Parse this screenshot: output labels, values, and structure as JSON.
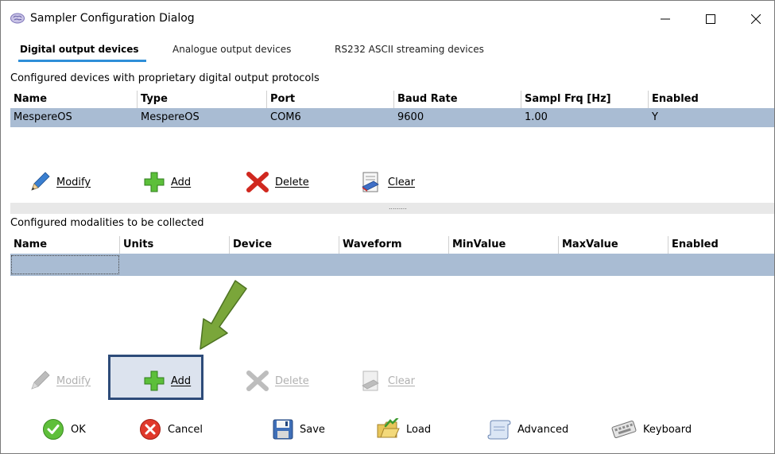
{
  "window": {
    "title": "Sampler Configuration Dialog"
  },
  "tabs": [
    {
      "label": "Digital output devices",
      "active": true
    },
    {
      "label": "Analogue output devices",
      "active": false
    },
    {
      "label": "RS232 ASCII streaming devices",
      "active": false
    }
  ],
  "devices": {
    "section_label": "Configured devices with proprietary digital output protocols",
    "columns": [
      "Name",
      "Type",
      "Port",
      "Baud Rate",
      "Sampl Frq [Hz]",
      "Enabled"
    ],
    "rows": [
      {
        "name": "MespereOS",
        "type": "MespereOS",
        "port": "COM6",
        "baud": "9600",
        "freq": "1.00",
        "enabled": "Y"
      }
    ],
    "toolbar": {
      "modify": "Modify",
      "add": "Add",
      "delete": "Delete",
      "clear": "Clear"
    }
  },
  "modalities": {
    "section_label": "Configured modalities to be collected",
    "columns": [
      "Name",
      "Units",
      "Device",
      "Waveform",
      "MinValue",
      "MaxValue",
      "Enabled"
    ],
    "toolbar": {
      "modify": "Modify",
      "add": "Add",
      "delete": "Delete",
      "clear": "Clear"
    }
  },
  "splitter": {
    "grip": "........."
  },
  "footer": {
    "ok": "OK",
    "cancel": "Cancel",
    "save": "Save",
    "load": "Load",
    "advanced": "Advanced",
    "keyboard": "Keyboard"
  },
  "colors": {
    "selected_row": "#a9bcd3",
    "tab_underline": "#2e8fd8",
    "highlight_border": "#2d4b79",
    "arrow": "#7aa63a"
  }
}
